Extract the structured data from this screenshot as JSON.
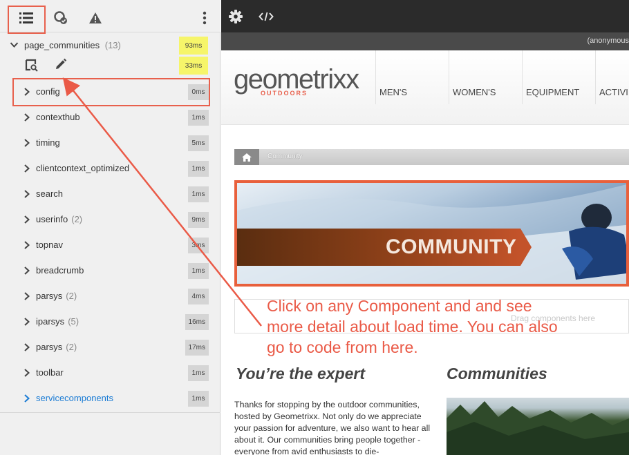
{
  "panel": {
    "root": {
      "label": "page_communities",
      "count": "(13)",
      "timing": "93ms",
      "sub_timing": "33ms"
    },
    "components": [
      {
        "label": "config",
        "count": "",
        "timing": "0ms"
      },
      {
        "label": "contexthub",
        "count": "",
        "timing": "1ms"
      },
      {
        "label": "timing",
        "count": "",
        "timing": "5ms"
      },
      {
        "label": "clientcontext_optimized",
        "count": "",
        "timing": "1ms"
      },
      {
        "label": "search",
        "count": "",
        "timing": "1ms"
      },
      {
        "label": "userinfo",
        "count": "(2)",
        "timing": "9ms"
      },
      {
        "label": "topnav",
        "count": "",
        "timing": "3ms"
      },
      {
        "label": "breadcrumb",
        "count": "",
        "timing": "1ms"
      },
      {
        "label": "parsys",
        "count": "(2)",
        "timing": "4ms"
      },
      {
        "label": "iparsys",
        "count": "(5)",
        "timing": "16ms"
      },
      {
        "label": "parsys",
        "count": "(2)",
        "timing": "17ms"
      },
      {
        "label": "toolbar",
        "count": "",
        "timing": "1ms"
      },
      {
        "label": "servicecomponents",
        "count": "",
        "timing": "1ms"
      }
    ],
    "toolbar_icons": [
      "list-icon",
      "component-status-icon",
      "warning-icon",
      "more-vertical-icon"
    ]
  },
  "editor": {
    "icons": [
      "gear-icon",
      "code-icon"
    ]
  },
  "site": {
    "user": "(anonymous",
    "logo": "geometrixx",
    "logo_sub": "OUTDOORS",
    "nav": [
      "MEN'S",
      "WOMEN'S",
      "EQUIPMENT",
      "ACTIVI"
    ],
    "breadcrumb": "Community",
    "banner_title": "COMMUNITY",
    "drag_hint": "Drag components here",
    "heading_left": "You’re the expert",
    "heading_right": "Communities",
    "paragraph": "Thanks for stopping by the outdoor communities, hosted by Geometrixx. Not only do we appreciate your passion for adventure, we also want to hear all about it. Our communities bring people together - everyone from avid enthusiasts to die-"
  },
  "annotation": "Click on any Component and and see more detail about load time. You can also go to code from here.",
  "colors": {
    "accent": "#e8604c",
    "timing_yellow": "#f6f56a",
    "link_blue": "#1a7bd4"
  }
}
